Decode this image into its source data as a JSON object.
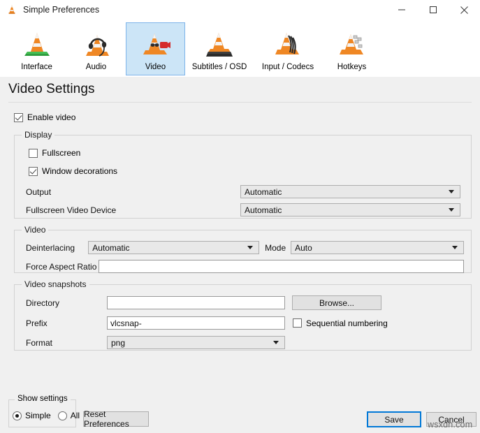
{
  "window": {
    "title": "Simple Preferences",
    "icon": "vlc-cone-icon",
    "controls": {
      "minimize": "minimize-icon",
      "maximize": "maximize-icon",
      "close": "close-icon"
    }
  },
  "toolbar": {
    "tabs": [
      {
        "label": "Interface",
        "icon": "vlc-cone-interface-icon",
        "selected": false
      },
      {
        "label": "Audio",
        "icon": "vlc-cone-headphones-icon",
        "selected": false
      },
      {
        "label": "Video",
        "icon": "vlc-cone-video-icon",
        "selected": true
      },
      {
        "label": "Subtitles / OSD",
        "icon": "vlc-cone-subtitles-icon",
        "selected": false
      },
      {
        "label": "Input / Codecs",
        "icon": "vlc-cone-input-icon",
        "selected": false
      },
      {
        "label": "Hotkeys",
        "icon": "vlc-cone-hotkeys-icon",
        "selected": false
      }
    ]
  },
  "page": {
    "title": "Video Settings"
  },
  "enable_video": {
    "label": "Enable video",
    "checked": true
  },
  "display_group": {
    "title": "Display",
    "fullscreen": {
      "label": "Fullscreen",
      "checked": false
    },
    "window_decorations": {
      "label": "Window decorations",
      "checked": true
    },
    "output": {
      "label": "Output",
      "value": "Automatic"
    },
    "fullscreen_video_device": {
      "label": "Fullscreen Video Device",
      "value": "Automatic"
    }
  },
  "video_group": {
    "title": "Video",
    "deinterlacing": {
      "label": "Deinterlacing",
      "value": "Automatic"
    },
    "mode": {
      "label": "Mode",
      "value": "Auto"
    },
    "force_aspect_ratio": {
      "label": "Force Aspect Ratio",
      "value": ""
    }
  },
  "snapshots_group": {
    "title": "Video snapshots",
    "directory": {
      "label": "Directory",
      "value": ""
    },
    "browse_label": "Browse...",
    "prefix": {
      "label": "Prefix",
      "value": "vlcsnap-"
    },
    "sequential_numbering": {
      "label": "Sequential numbering",
      "checked": false
    },
    "format": {
      "label": "Format",
      "value": "png"
    }
  },
  "footer": {
    "show_settings": {
      "title": "Show settings",
      "simple": {
        "label": "Simple",
        "selected": true
      },
      "all": {
        "label": "All",
        "selected": false
      }
    },
    "reset_label": "Reset Preferences",
    "save_label": "Save",
    "cancel_label": "Cancel"
  },
  "watermark": {
    "text": "wsxdn.com"
  },
  "colors": {
    "window_bg": "#f0f0f0",
    "titlebar_bg": "#ffffff",
    "tab_selected_bg": "#cce5f7",
    "tab_selected_border": "#7eb4ea",
    "combo_bg": "#e8e8e8",
    "focus_blue": "#0078d7",
    "cone_orange": "#ef8724",
    "cone_white": "#f4f4f4"
  }
}
